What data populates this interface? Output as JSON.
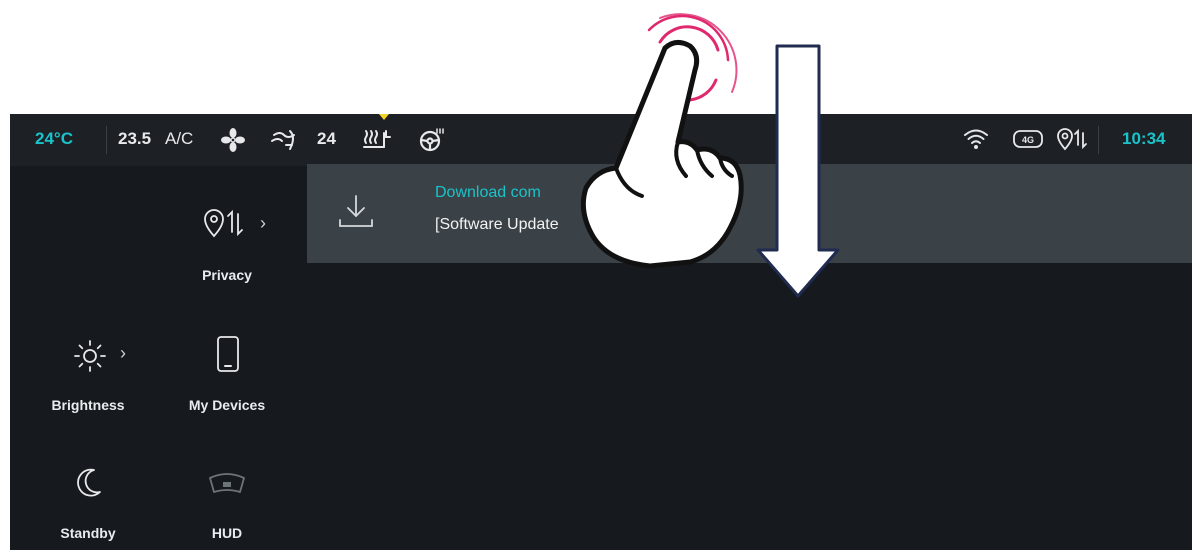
{
  "status_bar": {
    "temp_left": "24°C",
    "temp_center": "23.5",
    "ac_label": "A/C",
    "fan_speed": "24",
    "clock": "10:34",
    "network_label": "4G"
  },
  "notification": {
    "title": "Download com",
    "text": "[Software Update"
  },
  "tiles": {
    "privacy": "Privacy",
    "brightness": "Brightness",
    "my_devices": "My Devices",
    "standby": "Standby",
    "hud": "HUD"
  },
  "icons": {
    "fan": "fan-icon",
    "airflow": "airflow-icon",
    "seat_heat": "seat-heat-icon",
    "steering_heat": "steering-wheel-heat-icon",
    "wifi": "wifi-icon",
    "network": "4g-icon",
    "location": "location-icon",
    "download": "download-icon",
    "sun": "sun-icon",
    "phone": "phone-icon",
    "moon": "moon-icon",
    "hud": "hud-icon"
  },
  "colors": {
    "accent": "#19c3c9",
    "screen_bg": "#161a1f",
    "notification_bg": "#3b4247",
    "indicator": "#f3d229",
    "tap_ring": "#e0286e"
  }
}
